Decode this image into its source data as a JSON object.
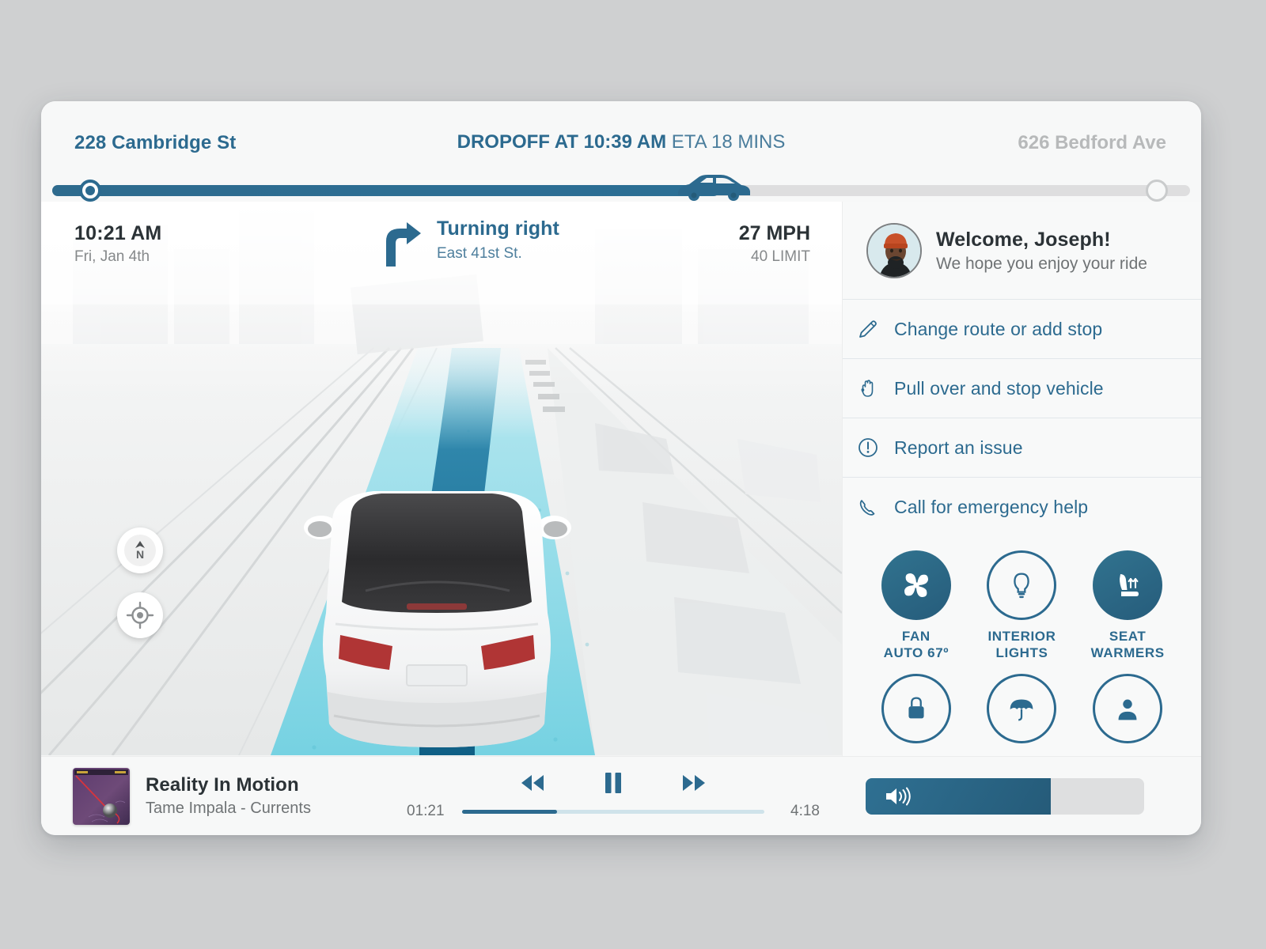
{
  "header": {
    "origin": "228 Cambridge St",
    "dropoff_prefix": "DROPOFF AT 10:39 AM",
    "eta": "ETA 18 MINS",
    "destination": "626 Bedford Ave",
    "progress_percent": 57.5
  },
  "nav": {
    "time": "10:21 AM",
    "date": "Fri, Jan 4th",
    "maneuver": "Turning right",
    "street": "East 41st St.",
    "speed": "27 MPH",
    "speed_limit": "40 LIMIT",
    "compass_label": "N",
    "zoom_in": "+",
    "zoom_out": "−"
  },
  "sidebar": {
    "welcome_title": "Welcome, Joseph!",
    "welcome_subtitle": "We hope you enjoy your ride",
    "menu": [
      {
        "label": "Change route or add stop",
        "icon": "pencil-icon"
      },
      {
        "label": "Pull over and stop vehicle",
        "icon": "hand-icon"
      },
      {
        "label": "Report an issue",
        "icon": "exclamation-circle-icon"
      },
      {
        "label": "Call for emergency help",
        "icon": "phone-icon"
      }
    ],
    "controls": [
      {
        "label_line1": "FAN",
        "label_line2": "AUTO 67º",
        "icon": "fan-icon",
        "state": "on"
      },
      {
        "label_line1": "INTERIOR",
        "label_line2": "LIGHTS",
        "icon": "lightbulb-icon",
        "state": "off"
      },
      {
        "label_line1": "SEAT",
        "label_line2": "WARMERS",
        "icon": "seat-warmer-icon",
        "state": "on"
      }
    ]
  },
  "media": {
    "track_title": "Reality In Motion",
    "track_artist": "Tame Impala - Currents",
    "elapsed": "01:21",
    "duration": "4:18",
    "progress_percent": 31.4,
    "volume_percent": 66.5,
    "rewind_icon": "rewind-icon",
    "pause_icon": "pause-icon",
    "forward_icon": "fast-forward-icon",
    "volume_icon": "speaker-icon"
  },
  "colors": {
    "accent": "#2c6a8f",
    "accent_dark": "#255b79",
    "muted": "#6f7375",
    "track_bg": "#dedfe0",
    "route_lane": "#8fdbe8",
    "route_line": "#1d6d92"
  }
}
